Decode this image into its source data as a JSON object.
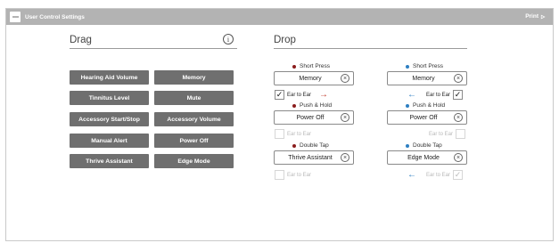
{
  "window": {
    "title": "User Control Settings",
    "print_label": "Print"
  },
  "drag": {
    "title": "Drag",
    "buttons": [
      "Hearing Aid Volume",
      "Memory",
      "Tinnitus Level",
      "Mute",
      "Accessory Start/Stop",
      "Accessory Volume",
      "Manual Alert",
      "Power Off",
      "Thrive Assistant",
      "Edge Mode"
    ]
  },
  "drop": {
    "title": "Drop",
    "left": {
      "dot_color": "#8b1c1c",
      "slots": [
        {
          "label": "Short Press",
          "value": "Memory",
          "ear_to_ear": "Ear to Ear",
          "checked": true,
          "enabled": true,
          "arrow": "→"
        },
        {
          "label": "Push & Hold",
          "value": "Power Off",
          "ear_to_ear": "Ear to Ear",
          "checked": false,
          "enabled": false,
          "arrow": ""
        },
        {
          "label": "Double Tap",
          "value": "Thrive Assistant",
          "ear_to_ear": "Ear to Ear",
          "checked": false,
          "enabled": false,
          "arrow": ""
        }
      ]
    },
    "right": {
      "dot_color": "#2e7fc2",
      "slots": [
        {
          "label": "Short Press",
          "value": "Memory",
          "ear_to_ear": "Ear to Ear",
          "checked": true,
          "enabled": true,
          "arrow": "←"
        },
        {
          "label": "Push & Hold",
          "value": "Power Off",
          "ear_to_ear": "Ear to Ear",
          "checked": false,
          "enabled": false,
          "arrow": ""
        },
        {
          "label": "Double Tap",
          "value": "Edge Mode",
          "ear_to_ear": "Ear to Ear",
          "checked": true,
          "enabled": false,
          "arrow": "←"
        }
      ]
    }
  },
  "icons": {
    "collapse": "minus-icon",
    "print": "arrow-icon",
    "info": "info-icon",
    "clear": "clear-circle-icon",
    "check": "✓"
  }
}
